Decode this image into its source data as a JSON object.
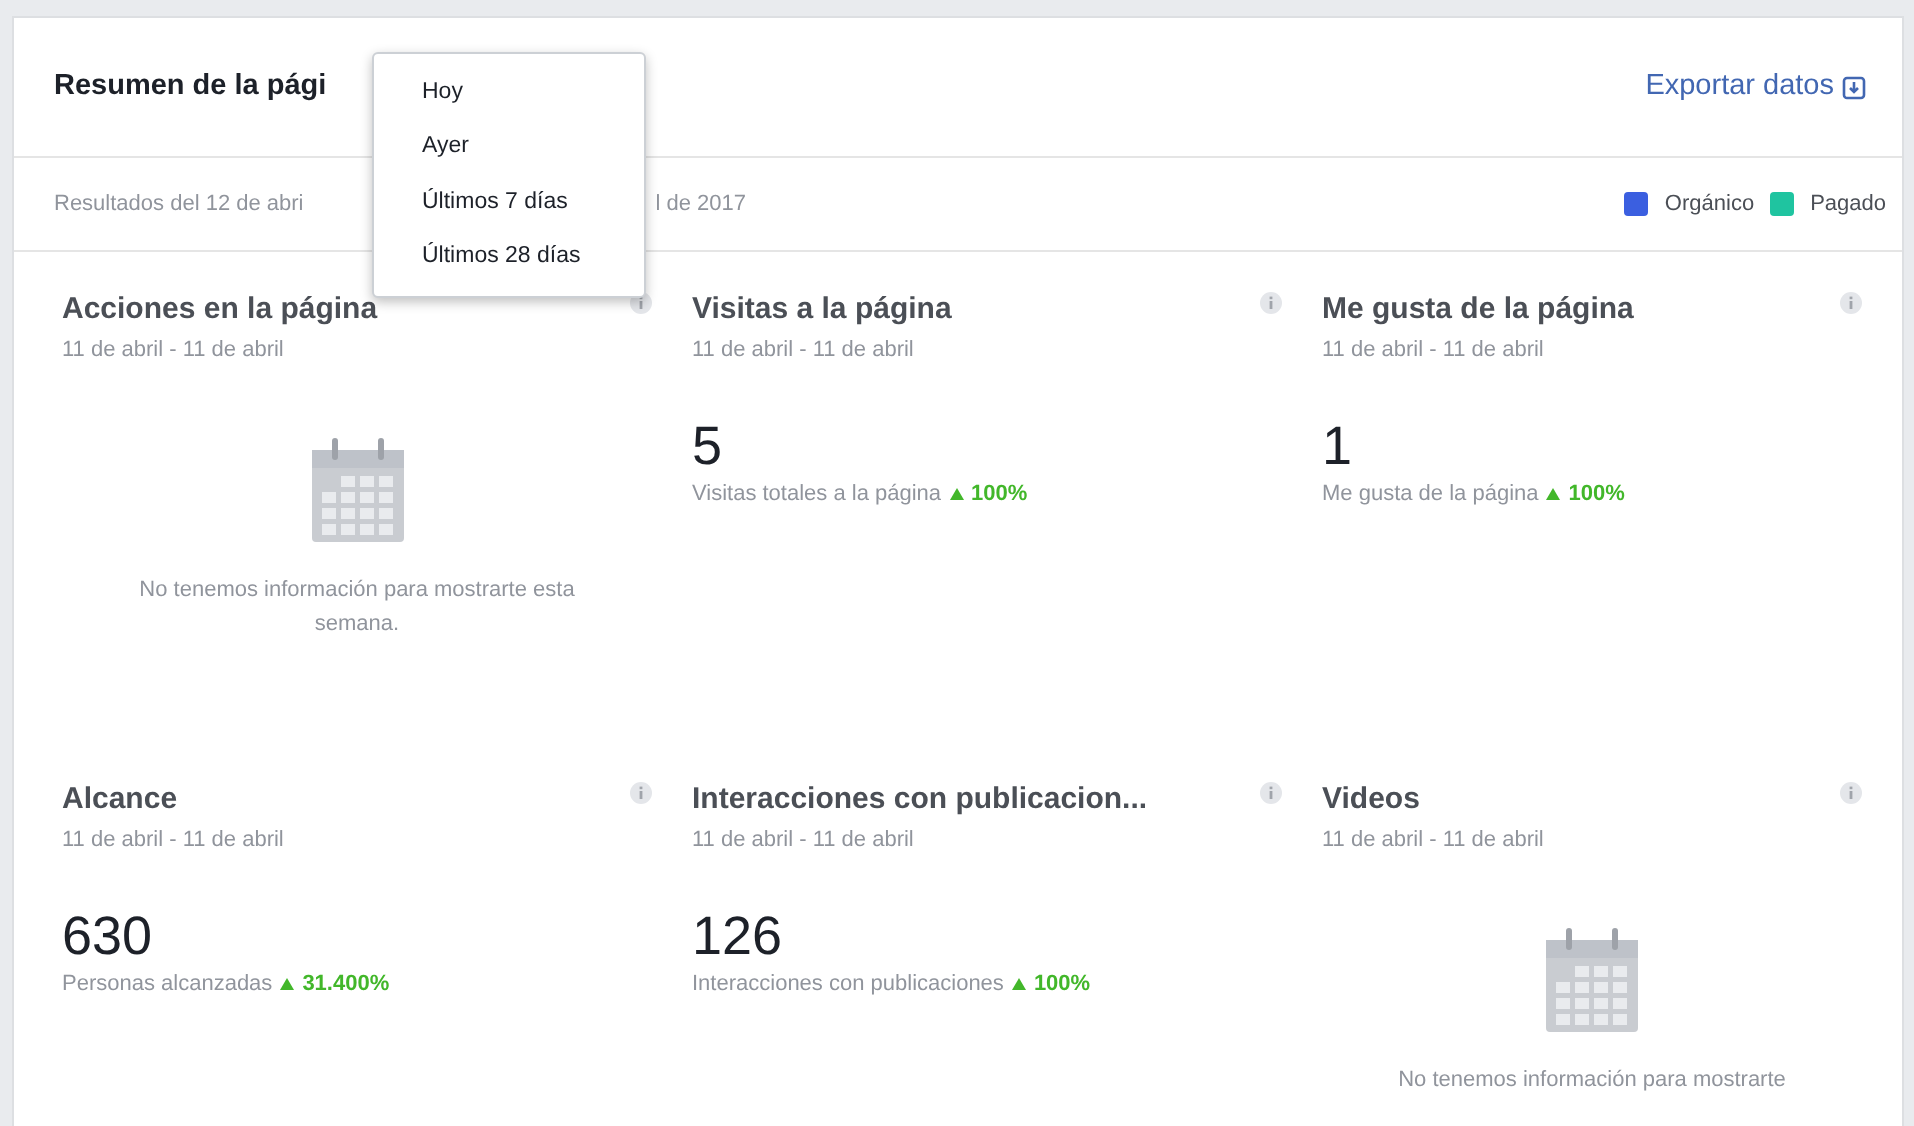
{
  "header": {
    "title": "Resumen de la pági",
    "export_link": "Exportar datos"
  },
  "date_menu": {
    "items": [
      {
        "label": "Hoy",
        "selected": false
      },
      {
        "label": "Ayer",
        "selected": false
      },
      {
        "label": "Últimos 7 días",
        "selected": false
      },
      {
        "label": "Últimos 28 días",
        "selected": false
      }
    ]
  },
  "subheader": {
    "range_start": "Resultados del 12 de abri",
    "range_end": "l de 2017",
    "legend": [
      {
        "label": "Orgánico",
        "color": "#3b5fe0"
      },
      {
        "label": "Pagado",
        "color": "#1fc4a0"
      }
    ]
  },
  "cards": [
    {
      "kind": "empty",
      "title": "Acciones en la página",
      "dates": "11 de abril - 11 de abril",
      "message": "No tenemos información para mostrarte esta semana."
    },
    {
      "kind": "metric",
      "title": "Visitas a la página",
      "dates": "11 de abril - 11 de abril",
      "value": "5",
      "caption": "Visitas totales a la página",
      "change": "100%"
    },
    {
      "kind": "metric",
      "title": "Me gusta de la página",
      "dates": "11 de abril - 11 de abril",
      "value": "1",
      "caption": "Me gusta de la página",
      "change": "100%"
    },
    {
      "kind": "metric",
      "title": "Alcance",
      "dates": "11 de abril - 11 de abril",
      "value": "630",
      "caption": "Personas alcanzadas",
      "change": "31.400%"
    },
    {
      "kind": "metric",
      "title": "Interacciones con publicacion...",
      "dates": "11 de abril - 11 de abril",
      "value": "126",
      "caption": "Interacciones con publicaciones",
      "change": "100%"
    },
    {
      "kind": "empty",
      "title": "Videos",
      "dates": "11 de abril - 11 de abril",
      "message": "No tenemos información para mostrarte"
    }
  ]
}
